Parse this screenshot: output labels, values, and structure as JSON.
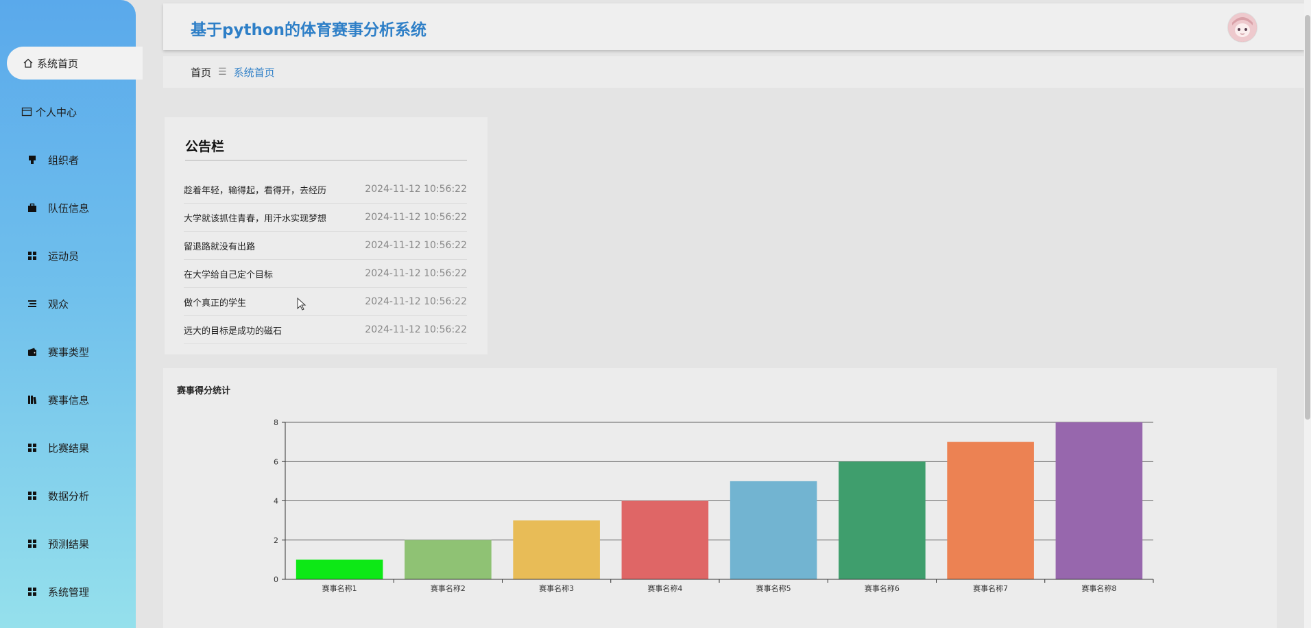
{
  "app": {
    "title": "基于python的体育赛事分析系统"
  },
  "sidebar": {
    "items": [
      {
        "label": "系统首页",
        "icon": "home-icon",
        "active": true
      },
      {
        "label": "个人中心",
        "icon": "profile-icon"
      },
      {
        "label": "组织者",
        "icon": "organizer-icon"
      },
      {
        "label": "队伍信息",
        "icon": "briefcase-icon"
      },
      {
        "label": "运动员",
        "icon": "grid-icon"
      },
      {
        "label": "观众",
        "icon": "list-icon"
      },
      {
        "label": "赛事类型",
        "icon": "wallet-icon"
      },
      {
        "label": "赛事信息",
        "icon": "book-icon"
      },
      {
        "label": "比赛结果",
        "icon": "grid-icon"
      },
      {
        "label": "数据分析",
        "icon": "grid-icon"
      },
      {
        "label": "预测结果",
        "icon": "grid-icon"
      },
      {
        "label": "系统管理",
        "icon": "grid-icon"
      }
    ]
  },
  "breadcrumb": {
    "home": "首页",
    "separator": "☰",
    "current": "系统首页"
  },
  "notice": {
    "title": "公告栏",
    "items": [
      {
        "text": "趁着年轻，输得起，看得开，去经历",
        "date": "2024-11-12 10:56:22"
      },
      {
        "text": "大学就该抓住青春，用汗水实现梦想",
        "date": "2024-11-12 10:56:22"
      },
      {
        "text": "留退路就没有出路",
        "date": "2024-11-12 10:56:22"
      },
      {
        "text": "在大学给自己定个目标",
        "date": "2024-11-12 10:56:22"
      },
      {
        "text": "做个真正的学生",
        "date": "2024-11-12 10:56:22"
      },
      {
        "text": "远大的目标是成功的磁石",
        "date": "2024-11-12 10:56:22"
      }
    ]
  },
  "chart_data": {
    "type": "bar",
    "title": "赛事得分统计",
    "categories": [
      "赛事名称1",
      "赛事名称2",
      "赛事名称3",
      "赛事名称4",
      "赛事名称5",
      "赛事名称6",
      "赛事名称7",
      "赛事名称8"
    ],
    "values": [
      1,
      2,
      3,
      4,
      5,
      6,
      7,
      8
    ],
    "colors": [
      "#0de816",
      "#8fc274",
      "#e8bc57",
      "#df6666",
      "#72b4d1",
      "#3f9e6d",
      "#ec8253",
      "#9767ad"
    ],
    "ylim": [
      0,
      8
    ],
    "yticks": [
      0,
      2,
      4,
      6,
      8
    ],
    "grid": true,
    "xlabel": "",
    "ylabel": ""
  }
}
